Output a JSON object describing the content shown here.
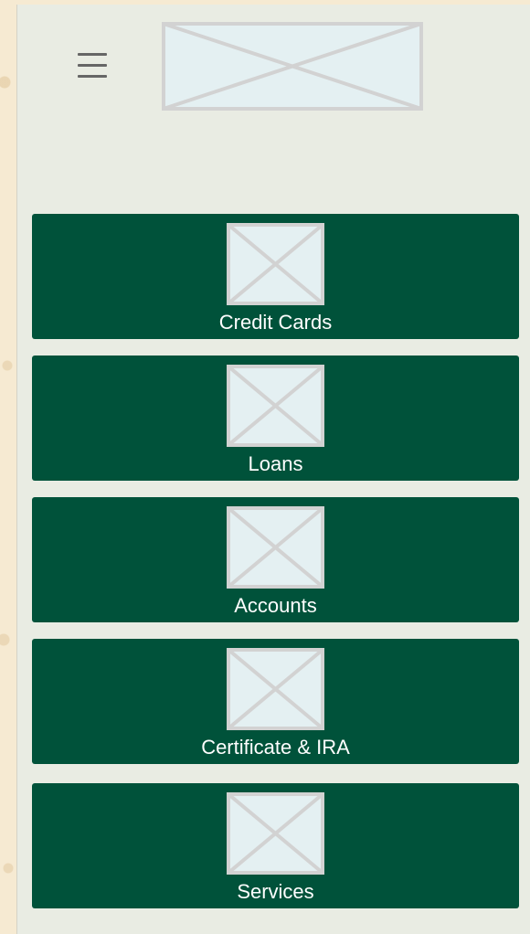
{
  "header": {
    "menu_icon": "hamburger-menu-icon",
    "logo": "image-placeholder"
  },
  "tiles": [
    {
      "label": "Credit Cards",
      "icon": "image-placeholder"
    },
    {
      "label": "Loans",
      "icon": "image-placeholder"
    },
    {
      "label": "Accounts",
      "icon": "image-placeholder"
    },
    {
      "label": "Certificate & IRA",
      "icon": "image-placeholder"
    },
    {
      "label": "Services",
      "icon": "image-placeholder"
    }
  ],
  "colors": {
    "page_background": "#f6ead2",
    "app_background": "#e9ece3",
    "tile_background": "#00523a",
    "tile_text": "#ffffff",
    "placeholder_fill": "#e4f0f2",
    "placeholder_stroke": "#d2d2d2",
    "menu_icon": "#666666"
  }
}
